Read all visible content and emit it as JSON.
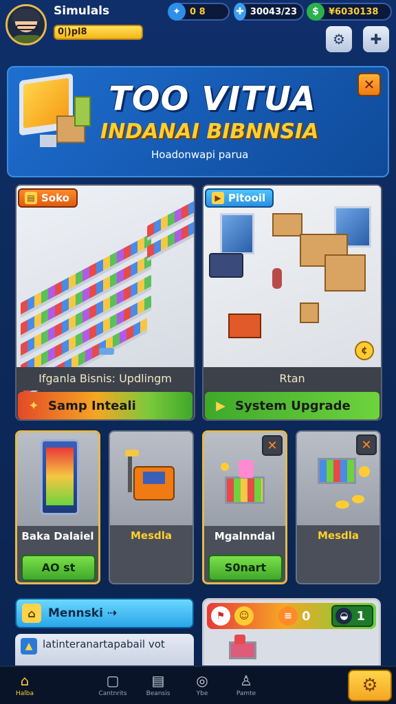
{
  "player": {
    "name": "Simulals",
    "level_label": "0|)pl8"
  },
  "resources": [
    {
      "icon": "gem-icon",
      "glyph": "✦",
      "value": "0 8"
    },
    {
      "icon": "plus-icon",
      "glyph": "✚",
      "value": "30043/23"
    },
    {
      "icon": "cash-icon",
      "glyph": "$",
      "value": "¥6030138"
    }
  ],
  "top_buttons": [
    {
      "icon": "profile-settings-icon",
      "glyph": "⚙"
    },
    {
      "icon": "puzzle-icon",
      "glyph": "✚"
    }
  ],
  "banner": {
    "title_line1": "TOO VITUA",
    "title_line2": "INDANAI BIBNNSIA",
    "subtitle": "Hoadonwapi parua",
    "close_glyph": "✕"
  },
  "big_cards": [
    {
      "tag": "Soko",
      "caption": "Ifganla Bisnis: Updlingm",
      "action": "Samp Inteali"
    },
    {
      "tag": "Pitooil",
      "caption": "Rtan",
      "action": "System Upgrade"
    }
  ],
  "small_cards": [
    {
      "label": "Baka Dalaiel",
      "label_color": "white",
      "button": "AO st"
    },
    {
      "label": "Mesdla",
      "label_color": "yellow",
      "button": ""
    },
    {
      "label": "Mgalnndal",
      "label_color": "white",
      "button": "S0nart"
    },
    {
      "label": "Mesdla",
      "label_color": "yellow",
      "button": ""
    }
  ],
  "menu": {
    "label": "Mennski ⇢"
  },
  "info": {
    "text": "latinteranartapabail vot"
  },
  "stats": {
    "coins": "0",
    "items": "1"
  },
  "nav": [
    {
      "label": "Halba",
      "glyph": "⌂"
    },
    {
      "label": "Cantnrits",
      "glyph": "▢"
    },
    {
      "label": "Beansis",
      "glyph": "▤"
    },
    {
      "label": "Ybe",
      "glyph": "◎"
    },
    {
      "label": "Pamte",
      "glyph": "♙"
    }
  ],
  "nav_settings_glyph": "⚙"
}
